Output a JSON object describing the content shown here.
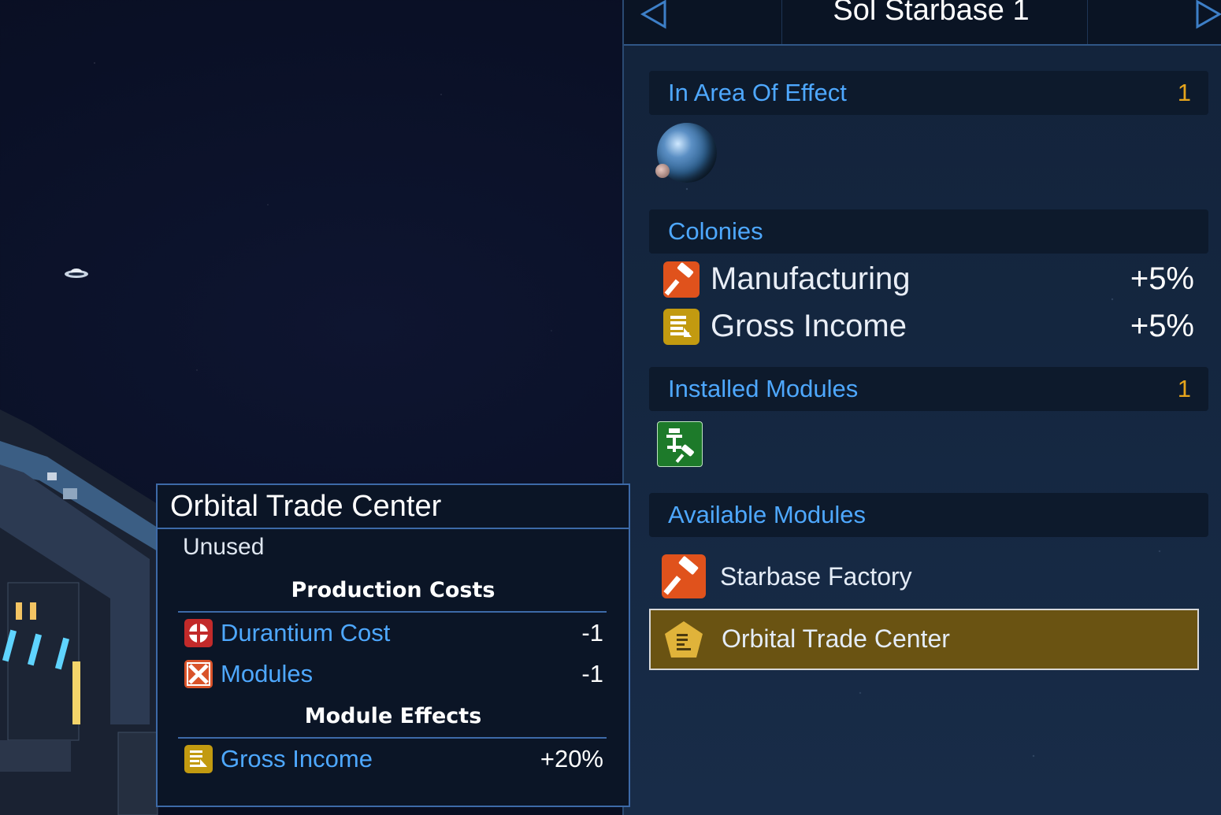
{
  "colors": {
    "accent_blue": "#4ea8ff",
    "count_orange": "#e6a51c",
    "manufacturing_icon": "#e0521c",
    "income_icon": "#c29a10",
    "module_green": "#1d7a2a",
    "selected_row": "#6a5312"
  },
  "panel": {
    "title": "Sol Starbase 1",
    "prev_icon": "chevron-left-icon",
    "next_icon": "chevron-right-icon",
    "area_of_effect": {
      "label": "In Area Of Effect",
      "count": "1",
      "items": [
        "planet-icon"
      ]
    },
    "colonies": {
      "label": "Colonies",
      "rows": [
        {
          "icon": "hammer-icon",
          "label": "Manufacturing",
          "value": "+5%"
        },
        {
          "icon": "income-icon",
          "label": "Gross Income",
          "value": "+5%"
        }
      ]
    },
    "installed_modules": {
      "label": "Installed Modules",
      "count": "1",
      "items": [
        "green-module-icon"
      ]
    },
    "available_modules": {
      "label": "Available Modules",
      "rows": [
        {
          "icon": "hammer-icon",
          "label": "Starbase Factory",
          "selected": false
        },
        {
          "icon": "trade-center-icon",
          "label": "Orbital Trade Center",
          "selected": true
        }
      ]
    }
  },
  "tooltip": {
    "title": "Orbital Trade Center",
    "status": "Unused",
    "production_costs": {
      "label": "Production Costs",
      "rows": [
        {
          "icon": "durantium-icon",
          "label": "Durantium Cost",
          "value": "-1"
        },
        {
          "icon": "modules-icon",
          "label": "Modules",
          "value": "-1"
        }
      ]
    },
    "module_effects": {
      "label": "Module Effects",
      "rows": [
        {
          "icon": "income-icon",
          "label": "Gross Income",
          "value": "+20%"
        }
      ]
    }
  }
}
